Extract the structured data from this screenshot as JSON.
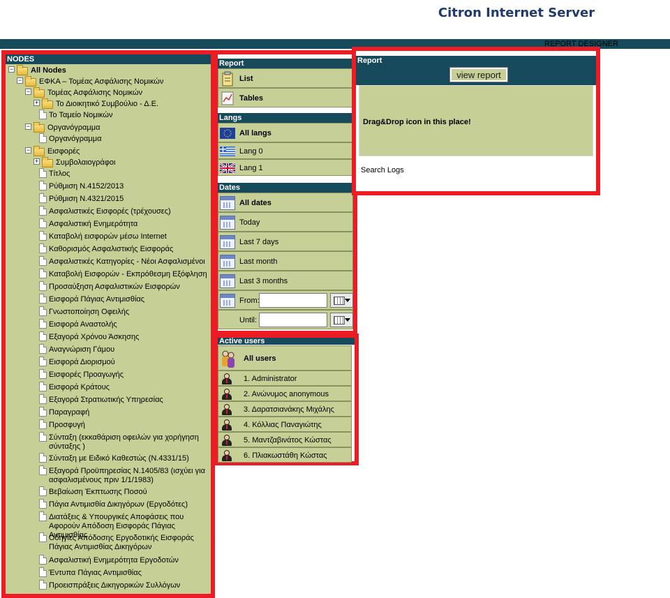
{
  "app_title": "Citron Internet Server",
  "topbar_label": "REPORT DESIGNER",
  "nodes": {
    "header": "NODES",
    "items": [
      {
        "label": "All Nodes",
        "level": 0,
        "type": "folder",
        "expander": "−",
        "bold": true
      },
      {
        "label": "ΕΦΚΑ – Τομέας Ασφάλισης Νομικών",
        "level": 1,
        "type": "folder",
        "expander": "−"
      },
      {
        "label": "Τομέας Ασφάλισης Νομικών",
        "level": 2,
        "type": "folder",
        "expander": "−"
      },
      {
        "label": "Το Διοικητικό Συμβούλιο - Δ.Ε.",
        "level": 3,
        "type": "folder",
        "expander": "+"
      },
      {
        "label": "Το Ταμείο Νομικών",
        "level": 3,
        "type": "doc"
      },
      {
        "label": "Οργανόγραμμα",
        "level": 2,
        "type": "folder",
        "expander": "−"
      },
      {
        "label": "Οργανόγραμμα",
        "level": 3,
        "type": "doc"
      },
      {
        "label": "Εισφορές",
        "level": 2,
        "type": "folder",
        "expander": "−"
      },
      {
        "label": "Συμβολαιογράφοι",
        "level": 3,
        "type": "folder",
        "expander": "+"
      },
      {
        "label": "Τίτλος",
        "level": 3,
        "type": "doc"
      },
      {
        "label": "Ρύθμιση Ν.4152/2013",
        "level": 3,
        "type": "doc"
      },
      {
        "label": "Ρύθμιση Ν.4321/2015",
        "level": 3,
        "type": "doc"
      },
      {
        "label": "Ασφαλιστικές Εισφορές (τρέχουσες)",
        "level": 3,
        "type": "doc"
      },
      {
        "label": "Ασφαλιστική Ενημερότητα",
        "level": 3,
        "type": "doc"
      },
      {
        "label": "Καταβολή εισφορών μέσω Internet",
        "level": 3,
        "type": "doc"
      },
      {
        "label": "Καθορισμός Ασφαλιστικής Εισφοράς",
        "level": 3,
        "type": "doc"
      },
      {
        "label": "Ασφαλιστικές Κατηγορίες - Νέοι Ασφαλισμένοι",
        "level": 3,
        "type": "doc"
      },
      {
        "label": "Καταβολή Εισφορών - Εκπρόθεσμη Εξόφληση",
        "level": 3,
        "type": "doc"
      },
      {
        "label": "Προσαύξηση Ασφαλιστικών Εισφορών",
        "level": 3,
        "type": "doc"
      },
      {
        "label": "Εισφορά Πάγιας Αντιμισθίας",
        "level": 3,
        "type": "doc"
      },
      {
        "label": "Γνωστοποίηση Οφειλής",
        "level": 3,
        "type": "doc"
      },
      {
        "label": "Εισφορά Αναστολής",
        "level": 3,
        "type": "doc"
      },
      {
        "label": "Εξαγορά Χρόνου Άσκησης",
        "level": 3,
        "type": "doc"
      },
      {
        "label": "Αναγνώριση Γάμου",
        "level": 3,
        "type": "doc"
      },
      {
        "label": "Εισφορά Διορισμού",
        "level": 3,
        "type": "doc"
      },
      {
        "label": "Εισφορές Προαγωγής",
        "level": 3,
        "type": "doc"
      },
      {
        "label": "Εισφορά Κράτους",
        "level": 3,
        "type": "doc"
      },
      {
        "label": "Εξαγορά Στρατιωτικής Υπηρεσίας",
        "level": 3,
        "type": "doc"
      },
      {
        "label": "Παραγραφή",
        "level": 3,
        "type": "doc"
      },
      {
        "label": "Προσφυγή",
        "level": 3,
        "type": "doc"
      },
      {
        "label": "Σύνταξη (εκκαθάριση οφειλών για χορήγηση σύνταξης )",
        "level": 3,
        "type": "doc"
      },
      {
        "label": "Σύνταξη με Ειδικό Καθεστώς (Ν.4331/15)",
        "level": 3,
        "type": "doc"
      },
      {
        "label": "Εξαγορά Προϋπηρεσίας Ν.1405/83 (ισχύει για ασφαλισμένους πριν 1/1/1983)",
        "level": 3,
        "type": "doc"
      },
      {
        "label": "Βεβαίωση Έκπτωσης Ποσού",
        "level": 3,
        "type": "doc"
      },
      {
        "label": "Πάγια Αντιμισθία Δικηγόρων (Εργοδότες)",
        "level": 3,
        "type": "doc"
      },
      {
        "label": "Διατάξεις & Υπουργικές Αποφάσεις που Αφορούν Απόδοση Εισφοράς Πάγιας Αντιμισθίας",
        "level": 3,
        "type": "doc"
      },
      {
        "label": "Οδηγίες Απόδοσης Εργοδοτικής Εισφοράς Πάγιας Αντιμισθίας Δικηγόρων",
        "level": 3,
        "type": "doc"
      },
      {
        "label": "Ασφαλιστική Ενημερότητα Εργοδοτών",
        "level": 3,
        "type": "doc"
      },
      {
        "label": "Έντυπα Πάγιας Αντιμισθίας",
        "level": 3,
        "type": "doc"
      },
      {
        "label": "Προεισπράξεις Δικηγορικών Συλλόγων",
        "level": 3,
        "type": "doc"
      }
    ]
  },
  "report_section": {
    "header": "Report",
    "items": [
      {
        "label": "List",
        "icon": "clipboard-icon"
      },
      {
        "label": "Tables",
        "icon": "chart-icon"
      }
    ]
  },
  "langs_section": {
    "header": "Langs",
    "items": [
      {
        "label": "All langs",
        "icon": "eu-flag-icon",
        "bold": true
      },
      {
        "label": "Lang 0",
        "icon": "greek-flag-icon"
      },
      {
        "label": "Lang 1",
        "icon": "uk-flag-icon"
      }
    ]
  },
  "dates_section": {
    "header": "Dates",
    "items": [
      {
        "label": "All dates",
        "bold": true
      },
      {
        "label": "Today"
      },
      {
        "label": "Last 7 days"
      },
      {
        "label": "Last month"
      },
      {
        "label": "Last 3 months"
      }
    ],
    "from_label": "From:",
    "until_label": "Until:",
    "from_value": "",
    "until_value": ""
  },
  "users_section": {
    "header": "Active users",
    "all_label": "All users",
    "items": [
      "1. Administrator",
      "2. Ανώνυμος anonymous",
      "3. Δαρατσιανάκης Μιχάλης",
      "4. Κόλλιας Παναγιώτης",
      "5. Μαντζαβινάτος Κώστας",
      "6. Πλιακωστάθη Κώστας"
    ]
  },
  "report_panel": {
    "header": "Report",
    "view_button": "view report",
    "drop_hint": "Drag&Drop icon in this place!",
    "search_logs": "Search Logs"
  },
  "colors": {
    "panel_bg": "#c6d096",
    "header_bg": "#16495a",
    "highlight": "#ec1c24",
    "title": "#1f3a6b"
  }
}
